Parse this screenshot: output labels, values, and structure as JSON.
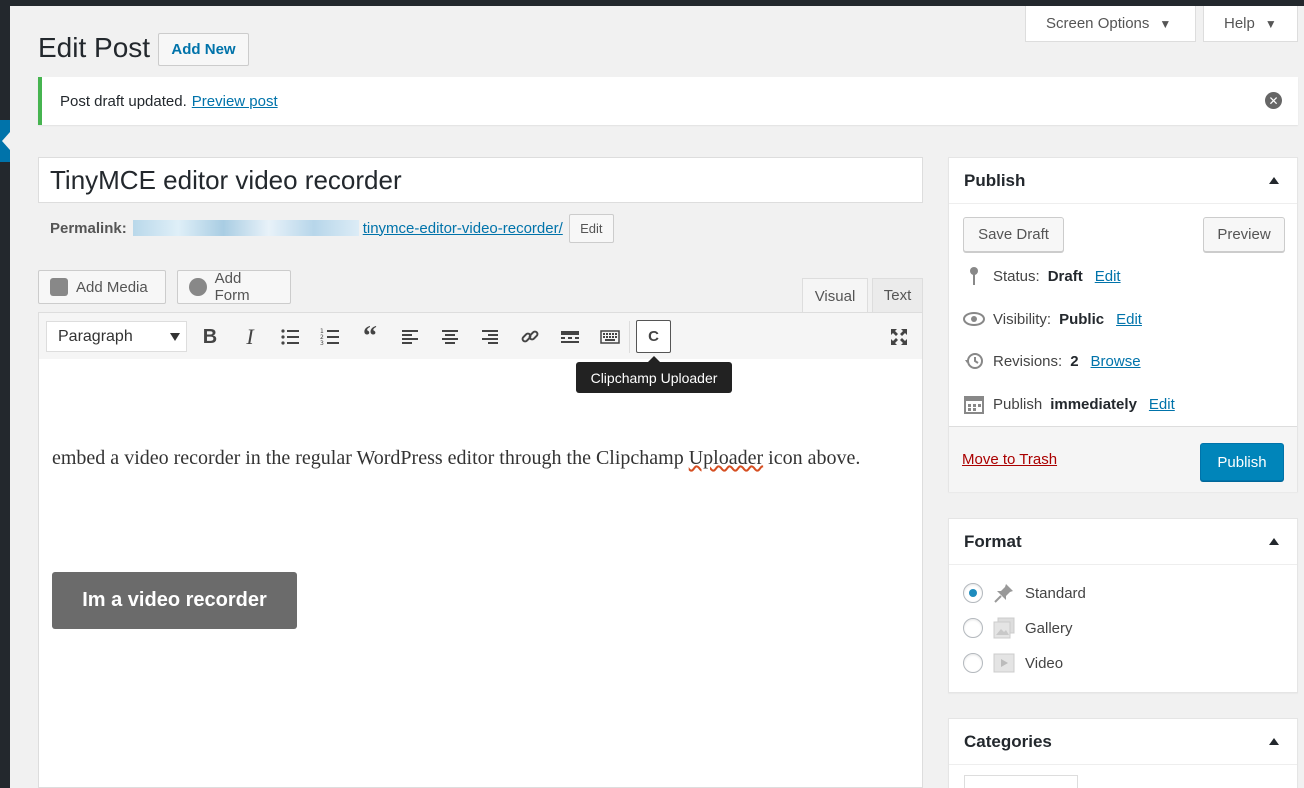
{
  "header": {
    "title": "Edit Post",
    "add_new": "Add New",
    "screen_options": "Screen Options",
    "help": "Help"
  },
  "notice": {
    "text": "Post draft updated.",
    "link": "Preview post"
  },
  "post": {
    "title": "TinyMCE editor video recorder",
    "permalink_label": "Permalink:",
    "permalink_slug": "tinymce-editor-video-recorder/",
    "permalink_edit": "Edit"
  },
  "media_buttons": {
    "add_media": "Add Media",
    "add_form": "Add Form"
  },
  "editor_tabs": {
    "visual": "Visual",
    "text": "Text"
  },
  "toolbar": {
    "format": "Paragraph",
    "clipchamp_label": "C",
    "tooltip": "Clipchamp Uploader"
  },
  "content": {
    "paragraph_before": "embed a video recorder in the regular WordPress editor through the Clipchamp ",
    "misspelled": "Uploader",
    "paragraph_after": " icon above.",
    "recorder_button": "Im a video recorder"
  },
  "publish": {
    "title": "Publish",
    "save_draft": "Save Draft",
    "preview": "Preview",
    "status_label": "Status:",
    "status_value": "Draft",
    "status_edit": "Edit",
    "visibility_label": "Visibility:",
    "visibility_value": "Public",
    "visibility_edit": "Edit",
    "revisions_label": "Revisions:",
    "revisions_value": "2",
    "revisions_browse": "Browse",
    "schedule_label": "Publish",
    "schedule_value": "immediately",
    "schedule_edit": "Edit",
    "trash": "Move to Trash",
    "publish_button": "Publish"
  },
  "format_box": {
    "title": "Format",
    "options": [
      {
        "label": "Standard",
        "selected": true
      },
      {
        "label": "Gallery",
        "selected": false
      },
      {
        "label": "Video",
        "selected": false
      }
    ]
  },
  "categories_box": {
    "title": "Categories"
  },
  "colors": {
    "accent": "#0073aa",
    "publish": "#0085ba",
    "notice_success": "#46b450",
    "trash": "#a00"
  }
}
